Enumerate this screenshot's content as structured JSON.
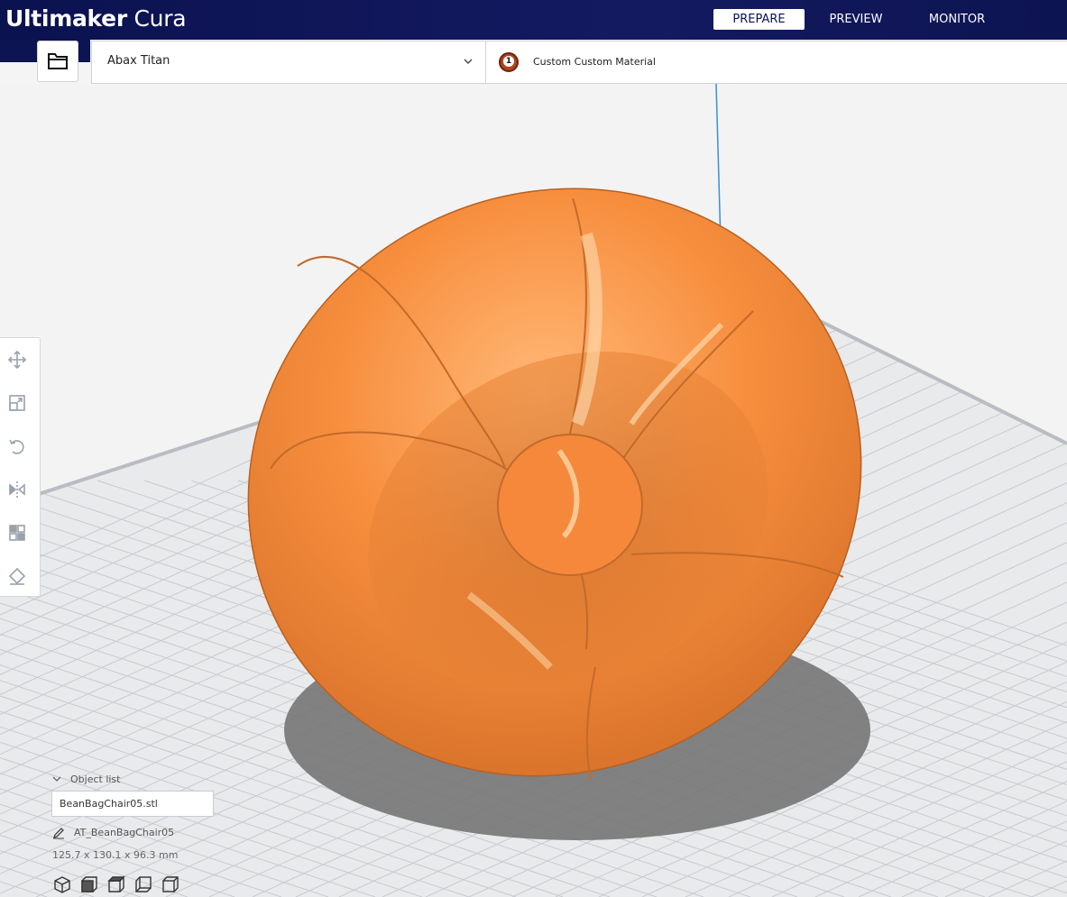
{
  "app": {
    "title_bold": "Ultimaker",
    "title_light": "Cura"
  },
  "stages": [
    {
      "label": "PREPARE",
      "active": true
    },
    {
      "label": "PREVIEW",
      "active": false
    },
    {
      "label": "MONITOR",
      "active": false
    }
  ],
  "printer": {
    "name": "Abax Titan"
  },
  "material": {
    "extruder_number": "1",
    "name": "Custom Custom Material"
  },
  "object_list": {
    "header": "Object list",
    "file_name": "BeanBagChair05.stl",
    "object_name": "AT_BeanBagChair05",
    "dimensions": "125.7 x 130.1 x 96.3 mm"
  },
  "colors": {
    "header_bg": "#0b1250",
    "model": "#f58a3a",
    "grid_line": "#c8cbd0"
  },
  "icons": {
    "toolbar": [
      "move-icon",
      "scale-icon",
      "rotate-icon",
      "mirror-icon",
      "per-model-settings-icon",
      "support-blocker-icon"
    ],
    "views": [
      "3d-view-icon",
      "front-view-icon",
      "top-view-icon",
      "left-view-icon",
      "right-view-icon"
    ]
  }
}
